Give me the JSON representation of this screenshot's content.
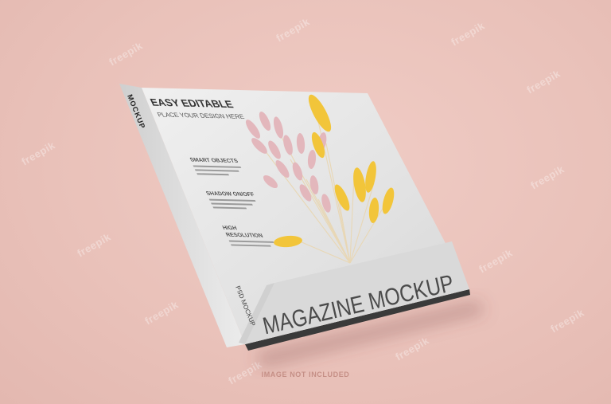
{
  "cover": {
    "headline": "EASY EDITABLE",
    "subheadline": "PLACE YOUR DESIGN HERE",
    "features": [
      {
        "title": "SMART OBJECTS"
      },
      {
        "title": "SHADOW ON/OFF"
      },
      {
        "title": "HIGH",
        "title2": "RESOLUTION"
      }
    ],
    "banner_title": "MAGAZINE MOCKUP"
  },
  "spine": {
    "title": "MOCKUP",
    "bottom_text": "PSD MOCKUP"
  },
  "watermark_text": "freepik",
  "footer_note": "IMAGE NOT INCLUDED",
  "colors": {
    "background": "#ecc6bf",
    "cover": "#e4e4e4",
    "banner": "#d9d9d9",
    "text_dark": "#4a4a4a",
    "flower_yellow": "#f2c53a",
    "flower_pink": "#e3b7bc"
  }
}
